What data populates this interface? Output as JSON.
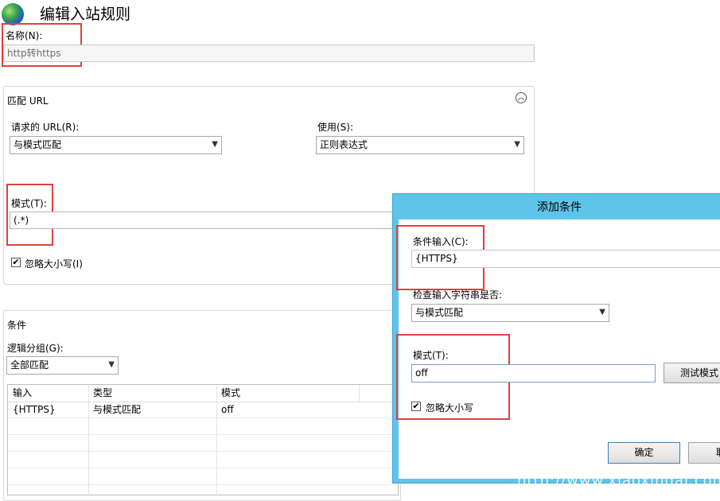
{
  "header": {
    "title": "编辑入站规则",
    "icon": "globe-icon"
  },
  "name_field": {
    "label": "名称(N):",
    "value": "http转https"
  },
  "match_url": {
    "title": "匹配 URL",
    "requested_url_label": "请求的 URL(R):",
    "requested_url_value": "与模式匹配",
    "using_label": "使用(S):",
    "using_value": "正则表达式",
    "pattern_label": "模式(T):",
    "pattern_value": "(.*)",
    "ignore_case_label": "忽略大小写(I)",
    "ignore_case_checked": true
  },
  "conditions": {
    "title": "条件",
    "logical_group_label": "逻辑分组(G):",
    "logical_group_value": "全部匹配",
    "columns": [
      "输入",
      "类型",
      "模式"
    ],
    "rows": [
      {
        "input": "{HTTPS}",
        "type": "与模式匹配",
        "pattern": "off"
      }
    ]
  },
  "dialog": {
    "title": "添加条件",
    "condition_input_label": "条件输入(C):",
    "condition_input_value": "{HTTPS}",
    "check_label": "检查输入字符串是否:",
    "check_value": "与模式匹配",
    "pattern_label": "模式(T):",
    "pattern_value": "off",
    "test_button": "测试模式",
    "ignore_case_label": "忽略大小写",
    "ignore_case_checked": true,
    "ok_button": "确定",
    "cancel_button": "取"
  },
  "watermark": "http://www.xiaoxingai.com",
  "colors": {
    "highlight": "#e0403a",
    "dialog_frame": "#5fc4ea"
  }
}
